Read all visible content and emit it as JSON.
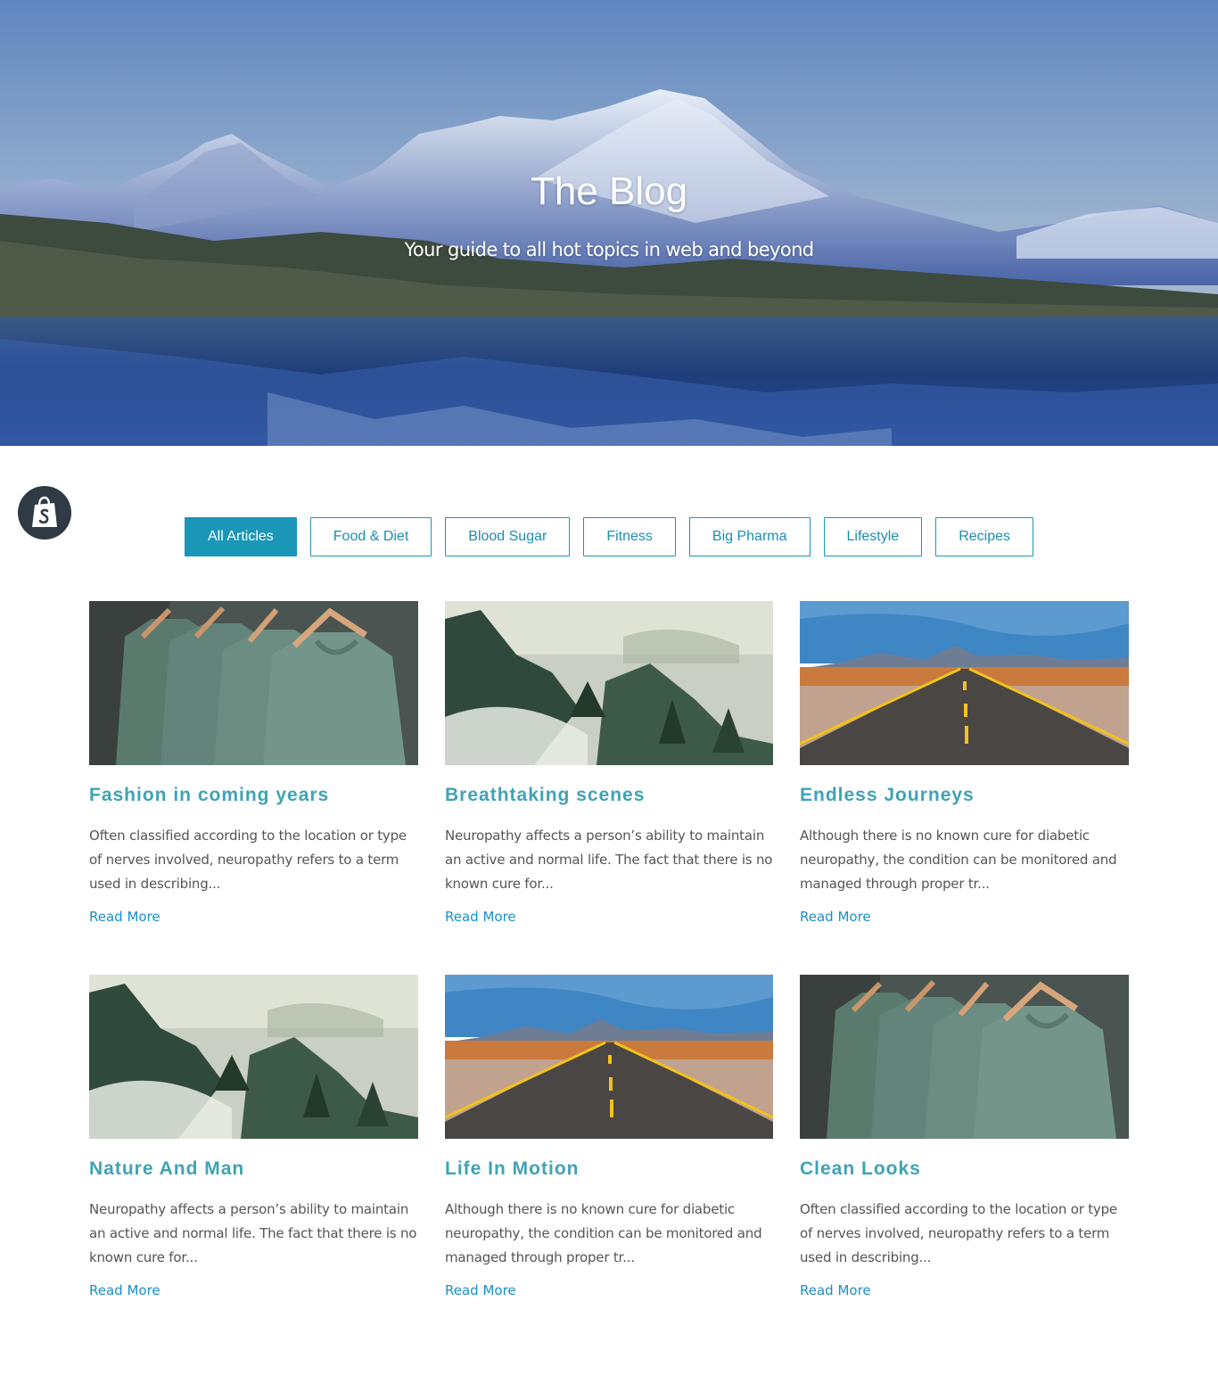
{
  "hero": {
    "title": "The Blog",
    "subtitle": "Your guide to all hot topics in web and beyond"
  },
  "shop_badge": {
    "icon": "shopify-bag-icon"
  },
  "filters": [
    {
      "label": "All Articles",
      "active": true
    },
    {
      "label": "Food & Diet",
      "active": false
    },
    {
      "label": "Blood Sugar",
      "active": false
    },
    {
      "label": "Fitness",
      "active": false
    },
    {
      "label": "Big Pharma",
      "active": false
    },
    {
      "label": "Lifestyle",
      "active": false
    },
    {
      "label": "Recipes",
      "active": false
    }
  ],
  "articles": [
    {
      "image": "shirts",
      "title": "Fashion in coming years",
      "excerpt": "Often classified according to the location or type of nerves involved, neuropathy refers to a term used in describing...",
      "link": "Read More"
    },
    {
      "image": "forest",
      "title": "Breathtaking scenes",
      "excerpt": "Neuropathy affects a person’s ability to maintain an active and normal life. The fact that there is no known cure for...",
      "link": "Read More"
    },
    {
      "image": "road",
      "title": "Endless Journeys",
      "excerpt": "Although there is no known cure for diabetic neuropathy, the condition can be monitored and managed through proper tr...",
      "link": "Read More"
    },
    {
      "image": "forest",
      "title": "Nature And Man",
      "excerpt": "Neuropathy affects a person’s ability to maintain an active and normal life. The fact that there is no known cure for...",
      "link": "Read More"
    },
    {
      "image": "road",
      "title": "Life In Motion",
      "excerpt": "Although there is no known cure for diabetic neuropathy, the condition can be monitored and managed through proper tr...",
      "link": "Read More"
    },
    {
      "image": "shirts",
      "title": "Clean Looks",
      "excerpt": "Often classified according to the location or type of nerves involved, neuropathy refers to a term used in describing...",
      "link": "Read More"
    }
  ],
  "colors": {
    "accent": "#1a96b8",
    "title": "#3fa3b4",
    "link": "#1a8fc9",
    "text": "#555555"
  }
}
